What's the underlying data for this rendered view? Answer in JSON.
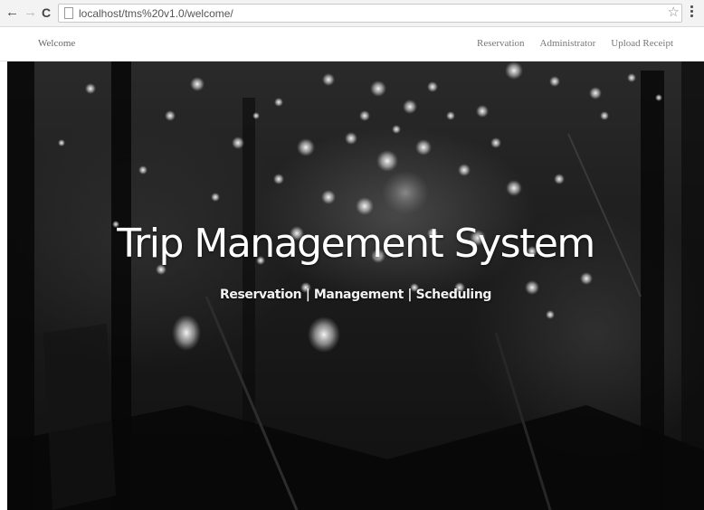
{
  "browser": {
    "url": "localhost/tms%20v1.0/welcome/",
    "icons": {
      "back": "back-arrow-icon",
      "forward": "forward-arrow-icon",
      "reload": "reload-icon",
      "page": "page-icon",
      "bookmark": "star-icon",
      "menu": "menu-icon"
    }
  },
  "navbar": {
    "brand": "Welcome",
    "links": [
      "Reservation",
      "Administrator",
      "Upload Receipt"
    ]
  },
  "hero": {
    "title": "Trip Management System",
    "subtitle": "Reservation | Management | Scheduling"
  },
  "colors": {
    "hero_overlay": "#111111",
    "title_text": "#ffffff",
    "nav_text": "#777777"
  }
}
